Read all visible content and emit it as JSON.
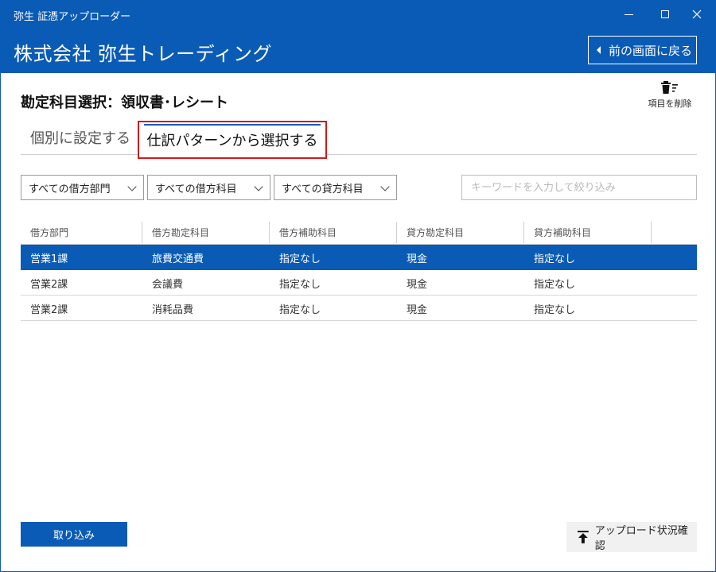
{
  "window": {
    "app_title": "弥生 証憑アップローダー"
  },
  "header": {
    "company": "株式会社 弥生トレーディング",
    "back_label": "前の画面に戻る"
  },
  "page": {
    "title": "勘定科目選択：領収書･レシート",
    "delete_label": "項目を削除"
  },
  "tabs": [
    {
      "label": "個別に設定する",
      "active": false
    },
    {
      "label": "仕訳パターンから選択する",
      "active": true
    }
  ],
  "filters": {
    "debit_dept": "すべての借方部門",
    "debit_account": "すべての借方科目",
    "credit_account": "すべての貸方科目",
    "keyword_placeholder": "キーワードを入力して絞り込み",
    "keyword_value": ""
  },
  "table": {
    "columns": [
      "借方部門",
      "借方勘定科目",
      "借方補助科目",
      "貸方勘定科目",
      "貸方補助科目"
    ],
    "rows": [
      [
        "営業1課",
        "旅費交通費",
        "指定なし",
        "現金",
        "指定なし"
      ],
      [
        "営業2課",
        "会議費",
        "指定なし",
        "現金",
        "指定なし"
      ],
      [
        "営業2課",
        "消耗品費",
        "指定なし",
        "現金",
        "指定なし"
      ]
    ],
    "selected_row": 0
  },
  "footer": {
    "import_label": "取り込み",
    "upload_status_label": "アップロード状況確認"
  },
  "colors": {
    "brand": "#0a5bb5",
    "highlight_border": "#d01c1c"
  },
  "icons": {
    "back": "chevron-left-icon",
    "delete": "trash-icon",
    "upload": "upload-arrow-icon",
    "minimize": "minimize-icon",
    "maximize": "maximize-icon",
    "close": "close-icon"
  }
}
